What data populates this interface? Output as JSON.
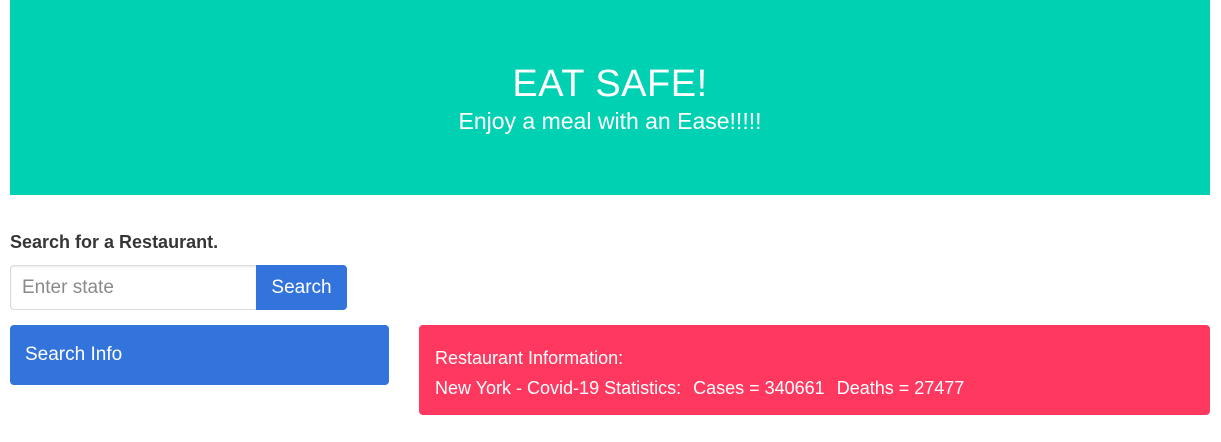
{
  "hero": {
    "title": "EAT SAFE!",
    "subtitle": "Enjoy a meal with an Ease!!!!!",
    "background_color": "#00d1b2"
  },
  "search": {
    "heading": "Search for a Restaurant.",
    "placeholder": "Enter state",
    "value": "",
    "button_label": "Search",
    "button_color": "#3273dc"
  },
  "search_info": {
    "label": "Search Info",
    "color": "#3273dc"
  },
  "restaurant_info": {
    "heading": "Restaurant Information:",
    "stats_prefix": "New York - Covid-19 Statistics:",
    "cases_text": "Cases = 340661",
    "deaths_text": "Deaths = 27477",
    "color": "#ff3860"
  }
}
